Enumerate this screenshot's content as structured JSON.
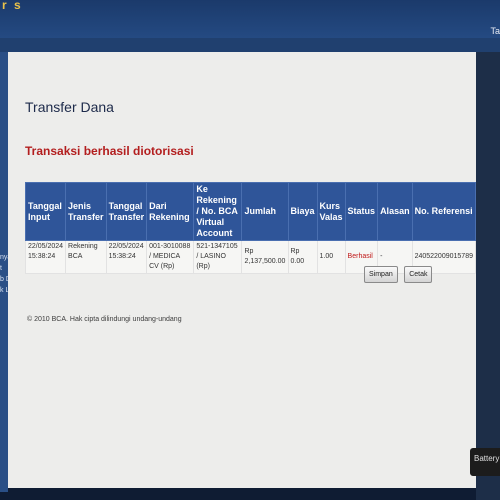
{
  "app": {
    "logo_text": "r s",
    "top_right_text": "Ta"
  },
  "left_partial": [
    "nya",
    "t",
    "b D",
    "k L"
  ],
  "page": {
    "title": "Transfer Dana",
    "status_message": "Transaksi berhasil diotorisasi"
  },
  "table": {
    "headers": [
      "Tanggal Input",
      "Jenis Transfer",
      "Tanggal Transfer",
      "Dari Rekening",
      "Ke Rekening / No. BCA Virtual Account",
      "Jumlah",
      "Biaya",
      "Kurs Valas",
      "Status",
      "Alasan",
      "No. Referensi"
    ],
    "rows": [
      {
        "tanggal_input": "22/05/2024 15:38:24",
        "jenis_transfer": "Rekening BCA",
        "tanggal_transfer": "22/05/2024 15:38:24",
        "dari_rekening": "001-3010088 / MEDICA CV (Rp)",
        "ke_rekening": "521-1347105 / LASINO (Rp)",
        "jumlah": "Rp 2,137,500.00",
        "biaya": "Rp 0.00",
        "kurs_valas": "1.00",
        "status": "Berhasil",
        "alasan": "-",
        "no_referensi": "240522009015789"
      }
    ]
  },
  "buttons": {
    "save_label": "Simpan",
    "print_label": "Cetak"
  },
  "footer": {
    "copyright": "© 2010 BCA. Hak cipta dilindungi undang-undang"
  },
  "overlay": {
    "battery_text": "Battery"
  },
  "colors": {
    "header_bg": "#2f5599",
    "status_red": "#b31e1e",
    "panel_bg": "#ededeb",
    "top_bar": "#1b3a6b"
  }
}
